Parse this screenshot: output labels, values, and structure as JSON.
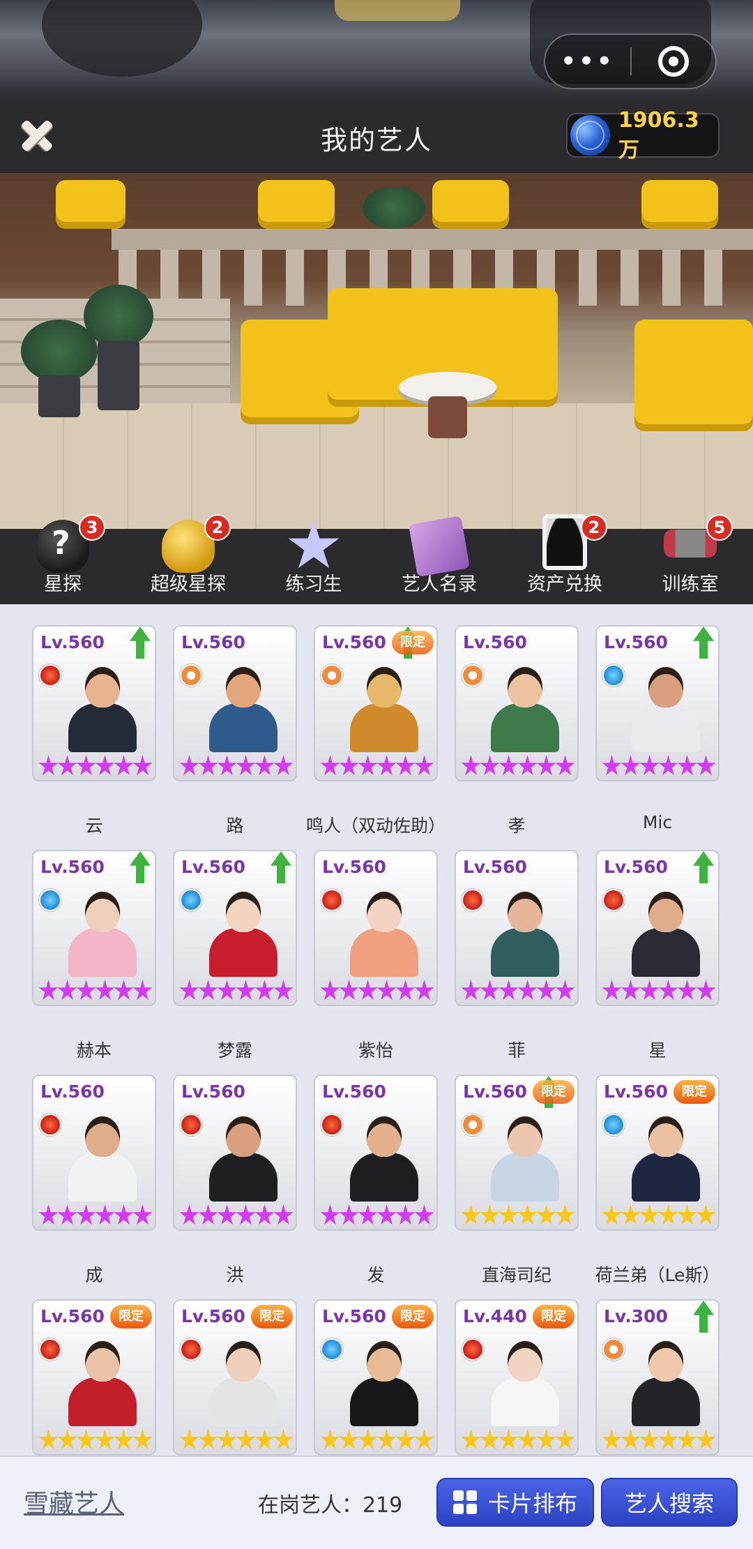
{
  "header": {
    "title": "我的艺人",
    "currency_amount": "1906.3万"
  },
  "mini_program": {
    "more_label": "•••"
  },
  "menu": [
    {
      "label": "星探",
      "badge": "3",
      "icon": "detective-hat-icon"
    },
    {
      "label": "超级星探",
      "badge": "2",
      "icon": "gold-hat-icon"
    },
    {
      "label": "练习生",
      "badge": "",
      "icon": "trainee-star-icon"
    },
    {
      "label": "艺人名录",
      "badge": "",
      "icon": "artist-book-icon"
    },
    {
      "label": "资产兑换",
      "badge": "2",
      "icon": "silhouette-card-icon"
    },
    {
      "label": "训练室",
      "badge": "5",
      "icon": "dumbbell-icon"
    }
  ],
  "cards": [
    {
      "level": "Lv.560",
      "name": "云",
      "rank": "red",
      "stars": "purple",
      "tag": "up"
    },
    {
      "level": "Lv.560",
      "name": "路",
      "rank": "orange",
      "stars": "purple",
      "tag": ""
    },
    {
      "level": "Lv.560",
      "name": "鸣人（双动佐助）",
      "rank": "orange",
      "stars": "purple",
      "tag": "limited-up"
    },
    {
      "level": "Lv.560",
      "name": "孝",
      "rank": "orange",
      "stars": "purple",
      "tag": ""
    },
    {
      "level": "Lv.560",
      "name": "Mic",
      "rank": "blue",
      "stars": "purple",
      "tag": "up"
    },
    {
      "level": "Lv.560",
      "name": "赫本",
      "rank": "blue",
      "stars": "purple",
      "tag": "up"
    },
    {
      "level": "Lv.560",
      "name": "梦露",
      "rank": "blue",
      "stars": "purple",
      "tag": "up"
    },
    {
      "level": "Lv.560",
      "name": "紫怡",
      "rank": "red",
      "stars": "purple",
      "tag": ""
    },
    {
      "level": "Lv.560",
      "name": "菲",
      "rank": "red",
      "stars": "purple",
      "tag": ""
    },
    {
      "level": "Lv.560",
      "name": "星",
      "rank": "red",
      "stars": "purple",
      "tag": "up"
    },
    {
      "level": "Lv.560",
      "name": "成",
      "rank": "red",
      "stars": "purple",
      "tag": ""
    },
    {
      "level": "Lv.560",
      "name": "洪",
      "rank": "red",
      "stars": "purple",
      "tag": ""
    },
    {
      "level": "Lv.560",
      "name": "发",
      "rank": "red",
      "stars": "purple",
      "tag": ""
    },
    {
      "level": "Lv.560",
      "name": "直海司纪",
      "rank": "orange",
      "stars": "gold",
      "tag": "limited-up"
    },
    {
      "level": "Lv.560",
      "name": "荷兰弟（Le斯）",
      "rank": "blue",
      "stars": "gold",
      "tag": "limited"
    },
    {
      "level": "Lv.560",
      "name": "",
      "rank": "red",
      "stars": "gold",
      "tag": "limited"
    },
    {
      "level": "Lv.560",
      "name": "",
      "rank": "red",
      "stars": "gold",
      "tag": "limited"
    },
    {
      "level": "Lv.560",
      "name": "",
      "rank": "blue",
      "stars": "gold",
      "tag": "limited"
    },
    {
      "level": "Lv.440",
      "name": "",
      "rank": "red",
      "stars": "gold",
      "tag": "limited"
    },
    {
      "level": "Lv.300",
      "name": "",
      "rank": "orange",
      "stars": "gold",
      "tag": "up"
    }
  ],
  "limited_label": "限定",
  "bottom": {
    "snow_label": "雪藏艺人",
    "count_label": "在岗艺人：219",
    "layout_button": "卡片排布",
    "search_button": "艺人搜索"
  },
  "colors": {
    "accent_blue": "#3a52d8",
    "currency_gold": "#ffd447",
    "badge_red": "#d82c22",
    "star_purple": "#d33bf0",
    "star_gold": "#f8c71a"
  }
}
